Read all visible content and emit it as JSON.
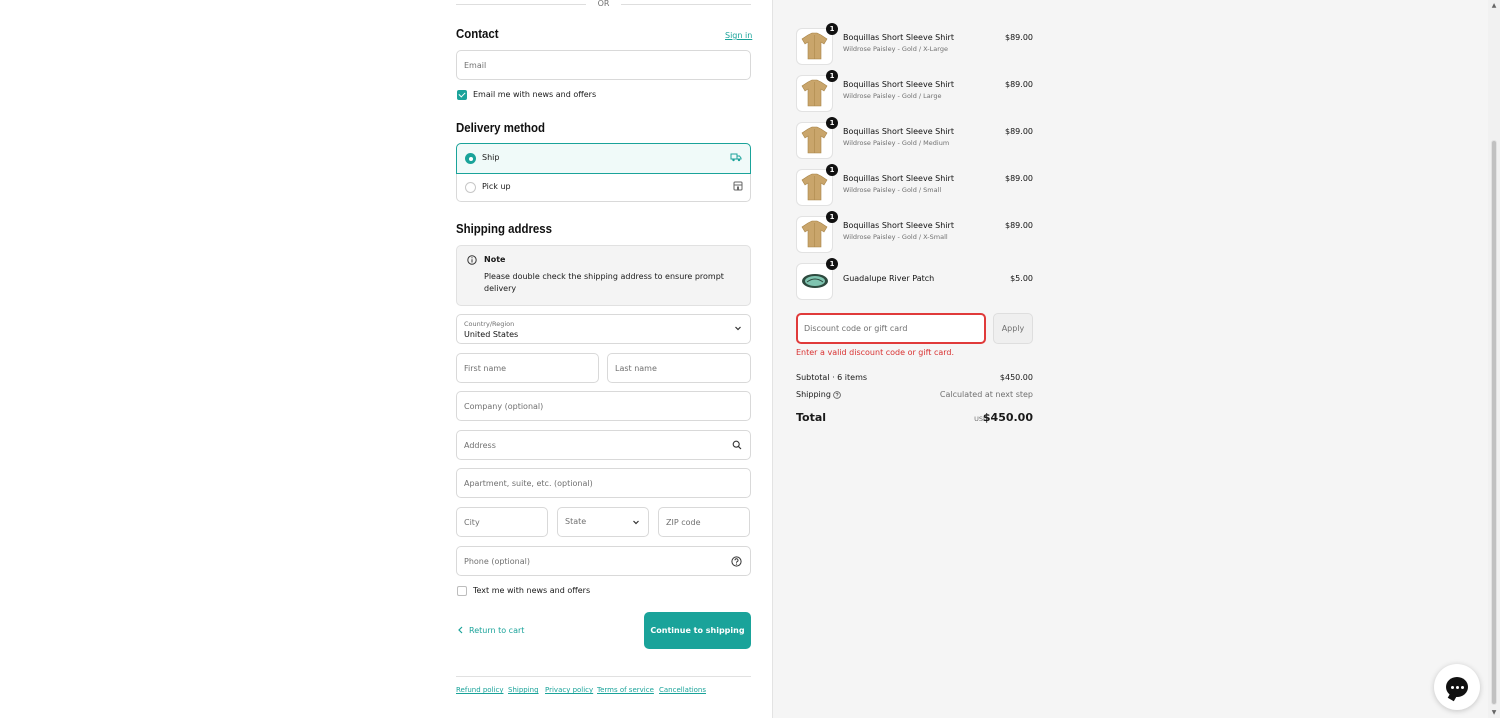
{
  "divider_or": "OR",
  "contact": {
    "heading": "Contact",
    "sign_in": "Sign in",
    "email_placeholder": "Email",
    "email_news_label": "Email me with news and offers"
  },
  "delivery": {
    "heading": "Delivery method",
    "options": [
      {
        "label": "Ship",
        "icon": "truck-icon",
        "selected": true
      },
      {
        "label": "Pick up",
        "icon": "store-icon",
        "selected": false
      }
    ]
  },
  "shipping": {
    "heading": "Shipping address",
    "note_title": "Note",
    "note_text": "Please double check the shipping address to ensure prompt delivery",
    "country_label": "Country/Region",
    "country_value": "United States",
    "first_name": "First name",
    "last_name": "Last name",
    "company": "Company (optional)",
    "address": "Address",
    "apartment": "Apartment, suite, etc. (optional)",
    "city": "City",
    "state": "State",
    "zip": "ZIP code",
    "phone": "Phone (optional)",
    "text_news_label": "Text me with news and offers"
  },
  "actions": {
    "return_to_cart": "Return to cart",
    "continue": "Continue to shipping"
  },
  "footer_links": [
    "Refund policy",
    "Shipping",
    "Privacy policy",
    "Terms of service",
    "Cancellations"
  ],
  "order": {
    "items": [
      {
        "name": "Boquillas Short Sleeve Shirt",
        "variant": "Wildrose Paisley - Gold / X-Large",
        "price": "$89.00",
        "qty": "1"
      },
      {
        "name": "Boquillas Short Sleeve Shirt",
        "variant": "Wildrose Paisley - Gold / Large",
        "price": "$89.00",
        "qty": "1"
      },
      {
        "name": "Boquillas Short Sleeve Shirt",
        "variant": "Wildrose Paisley - Gold / Medium",
        "price": "$89.00",
        "qty": "1"
      },
      {
        "name": "Boquillas Short Sleeve Shirt",
        "variant": "Wildrose Paisley - Gold / Small",
        "price": "$89.00",
        "qty": "1"
      },
      {
        "name": "Boquillas Short Sleeve Shirt",
        "variant": "Wildrose Paisley - Gold / X-Small",
        "price": "$89.00",
        "qty": "1"
      },
      {
        "name": "Guadalupe River Patch",
        "variant": "",
        "price": "$5.00",
        "qty": "1"
      }
    ],
    "discount_placeholder": "Discount code or gift card",
    "apply": "Apply",
    "discount_error": "Enter a valid discount code or gift card.",
    "subtotal_label": "Subtotal · 6 items",
    "subtotal_value": "$450.00",
    "shipping_label": "Shipping",
    "shipping_value": "Calculated at next step",
    "total_label": "Total",
    "currency": "USD",
    "total_value": "$450.00"
  },
  "colors": {
    "accent": "#1aa39a",
    "error": "#d93131"
  }
}
